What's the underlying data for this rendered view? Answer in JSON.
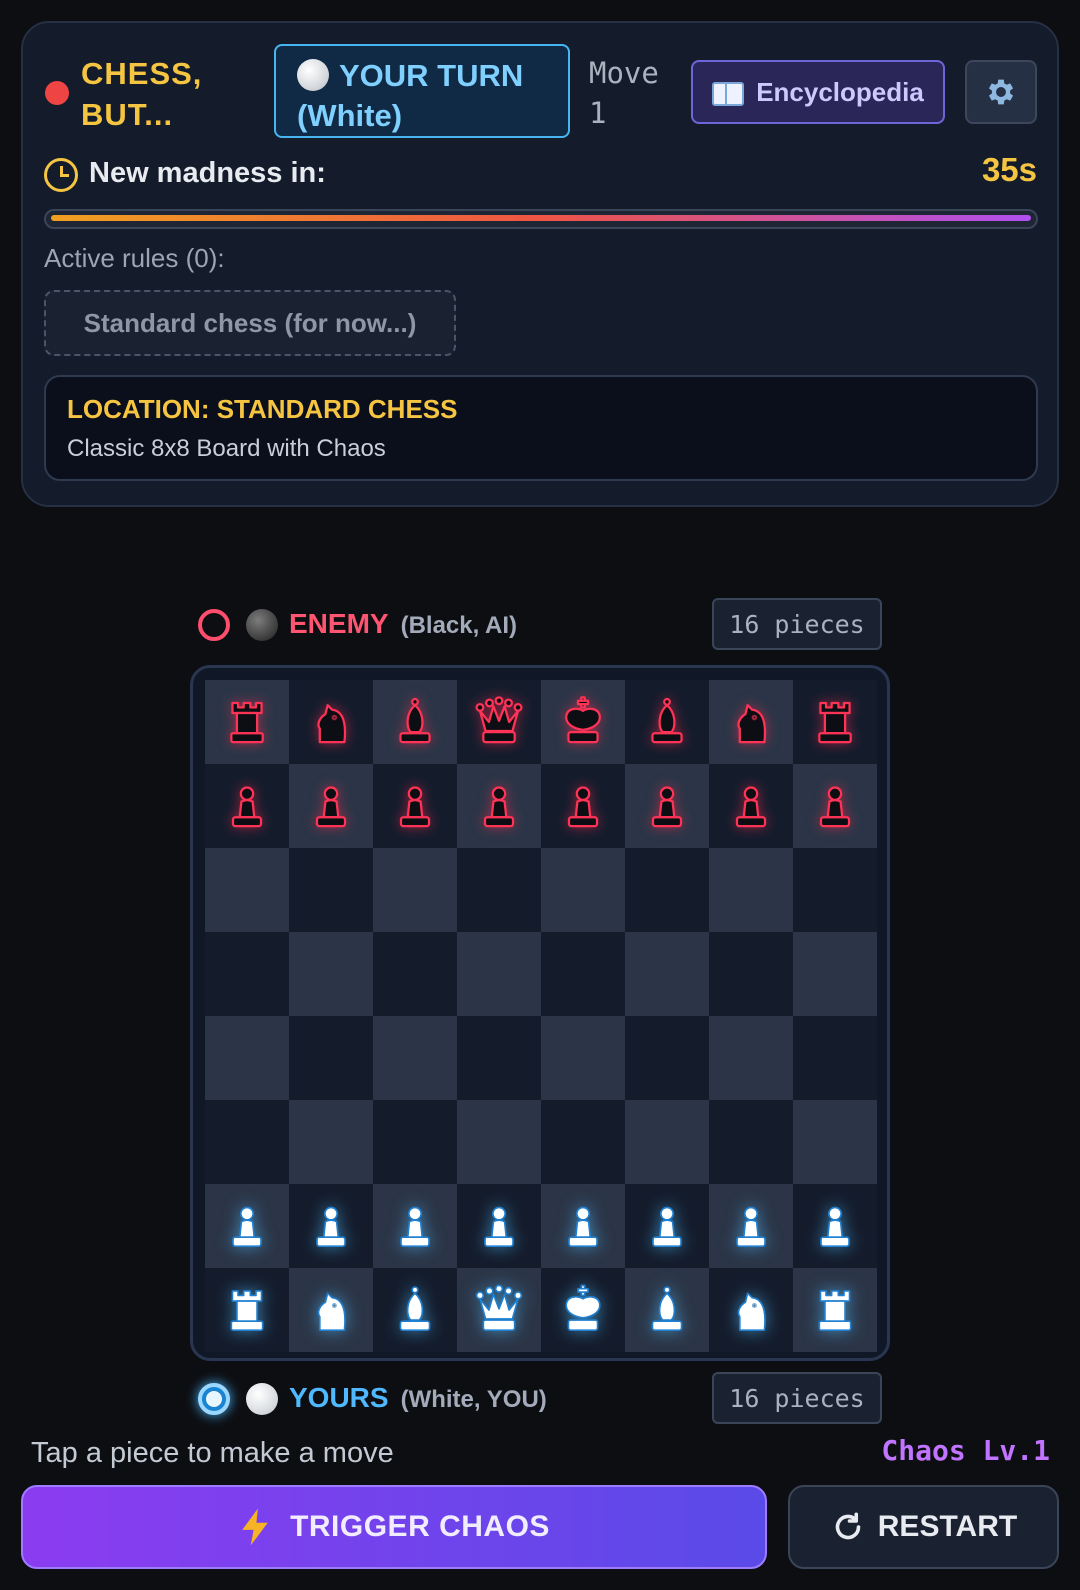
{
  "header": {
    "title": "CHESS, BUT...",
    "turn_label": "YOUR TURN (White)",
    "move_label": "Move",
    "move_number": "1",
    "encyclopedia_label": "Encyclopedia",
    "gear_icon": "gear-icon",
    "book_icon": "book-icon"
  },
  "timer": {
    "label": "New madness in:",
    "value": "35s",
    "progress": 1.0
  },
  "rules": {
    "label": "Active rules (0):",
    "chip": "Standard chess (for now...)"
  },
  "location": {
    "title": "LOCATION: STANDARD CHESS",
    "subtitle": "Classic 8x8 Board with Chaos"
  },
  "enemy": {
    "name": "ENEMY",
    "desc": "(Black, AI)",
    "pieces": "16 pieces"
  },
  "player": {
    "name": "YOURS",
    "desc": "(White, YOU)",
    "pieces": "16 pieces"
  },
  "board": {
    "rows": [
      [
        "bR",
        "bN",
        "bB",
        "bQ",
        "bK",
        "bB",
        "bN",
        "bR"
      ],
      [
        "bP",
        "bP",
        "bP",
        "bP",
        "bP",
        "bP",
        "bP",
        "bP"
      ],
      [
        "",
        "",
        "",
        "",
        "",
        "",
        "",
        ""
      ],
      [
        "",
        "",
        "",
        "",
        "",
        "",
        "",
        ""
      ],
      [
        "",
        "",
        "",
        "",
        "",
        "",
        "",
        ""
      ],
      [
        "",
        "",
        "",
        "",
        "",
        "",
        "",
        ""
      ],
      [
        "wP",
        "wP",
        "wP",
        "wP",
        "wP",
        "wP",
        "wP",
        "wP"
      ],
      [
        "wR",
        "wN",
        "wB",
        "wQ",
        "wK",
        "wB",
        "wN",
        "wR"
      ]
    ],
    "colors": {
      "black_piece": "#ff3355",
      "white_piece": "#ffffff",
      "white_outline": "#1f7fd0"
    }
  },
  "footer": {
    "hint": "Tap a piece to make a move",
    "chaos_level": "Chaos Lv.1",
    "trigger_label": "TRIGGER CHAOS",
    "restart_label": "RESTART"
  }
}
